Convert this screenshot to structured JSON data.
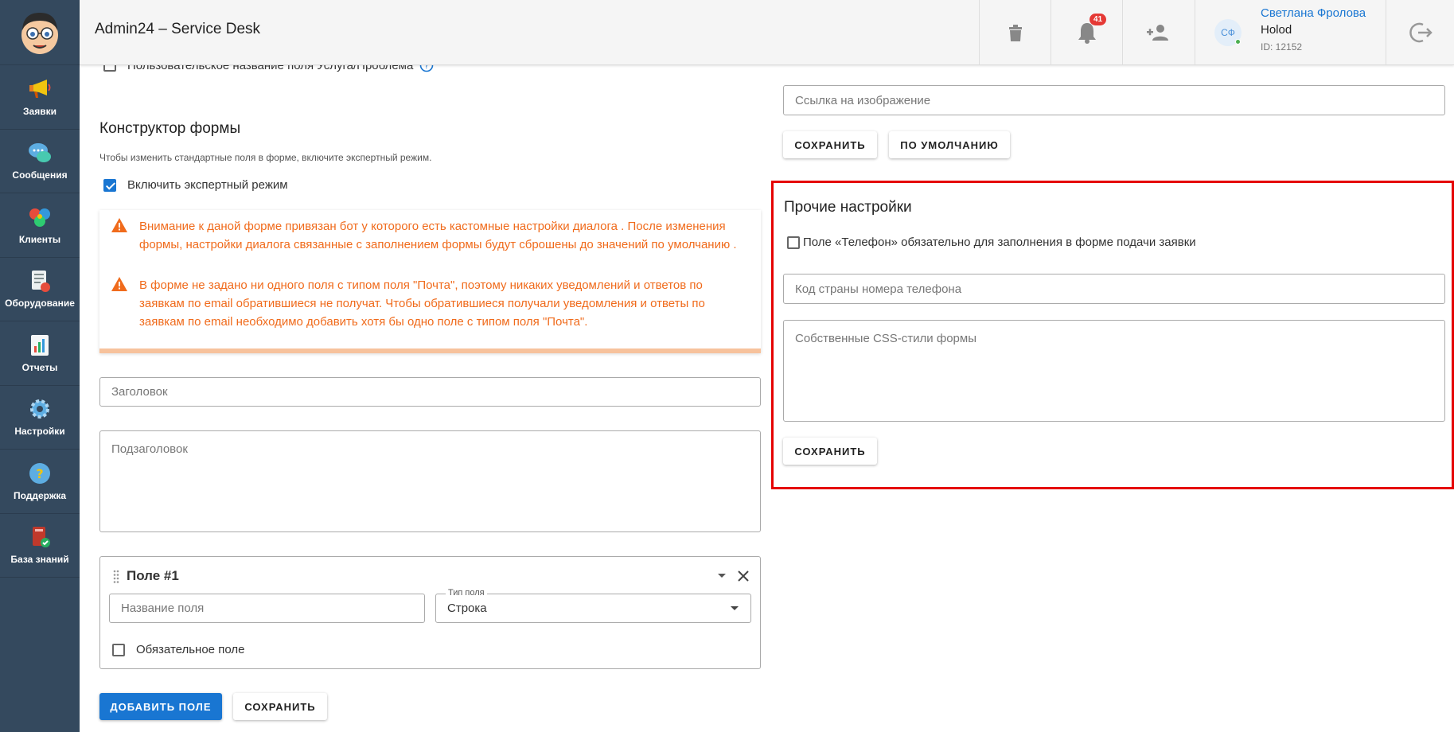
{
  "app": {
    "title": "Admin24 – Service Desk"
  },
  "sidebar": {
    "items": [
      {
        "label": "Заявки",
        "icon": "megaphone-icon"
      },
      {
        "label": "Сообщения",
        "icon": "chat-bubbles-icon"
      },
      {
        "label": "Клиенты",
        "icon": "clients-icon"
      },
      {
        "label": "Оборудование",
        "icon": "equipment-icon"
      },
      {
        "label": "Отчеты",
        "icon": "report-chart-icon"
      },
      {
        "label": "Настройки",
        "icon": "gear-icon"
      },
      {
        "label": "Поддержка",
        "icon": "help-icon"
      },
      {
        "label": "База знаний",
        "icon": "knowledge-book-icon"
      }
    ]
  },
  "header": {
    "notifications_count": "41",
    "user": {
      "initials": "СФ",
      "name": "Светлана Фролова",
      "company": "Holod",
      "id": "ID: 12152"
    }
  },
  "left": {
    "custom_service_field_label": "Пользовательское название поля Услуга/Проблема",
    "constructor_title": "Конструктор формы",
    "constructor_hint": "Чтобы изменить стандартные поля в форме, включите экспертный режим.",
    "expert_mode_label": "Включить экспертный режим",
    "expert_mode_checked": true,
    "alerts": [
      "Внимание к даной форме привязан бот у которого есть кастомные настройки диалога . После изменения формы, настройки диалога связанные с заполнением формы будут сброшены до значений по умолчанию .",
      "В форме не задано ни одного поля с типом поля \"Почта\", поэтому никаких уведомлений и ответов по заявкам по email обратившиеся не получат. Чтобы обратившиеся получали уведомления и ответы по заявкам по email необходимо добавить хотя бы одно поле с типом поля \"Почта\"."
    ],
    "title_placeholder": "Заголовок",
    "subtitle_placeholder": "Подзаголовок",
    "field_card": {
      "title": "Поле #1",
      "name_placeholder": "Название поля",
      "type_label": "Тип поля",
      "type_value": "Строка",
      "required_label": "Обязательное поле"
    },
    "add_field_button": "ДОБАВИТЬ ПОЛЕ",
    "save_button": "СОХРАНИТЬ"
  },
  "right": {
    "image_link_placeholder": "Ссылка на изображение",
    "save_button": "СОХРАНИТЬ",
    "default_button": "ПО УМОЛЧАНИЮ",
    "other_settings": {
      "title": "Прочие настройки",
      "phone_required_label": "Поле «Телефон» обязательно для заполнения в форме подачи заявки",
      "country_code_placeholder": "Код страны номера телефона",
      "css_placeholder": "Собственные CSS-стили формы",
      "save_button": "СОХРАНИТЬ"
    }
  },
  "colors": {
    "sidebar": "#34495e",
    "primary": "#1976d2",
    "warning": "#f06b1c",
    "highlight": "#e50000",
    "badge": "#e53935"
  }
}
